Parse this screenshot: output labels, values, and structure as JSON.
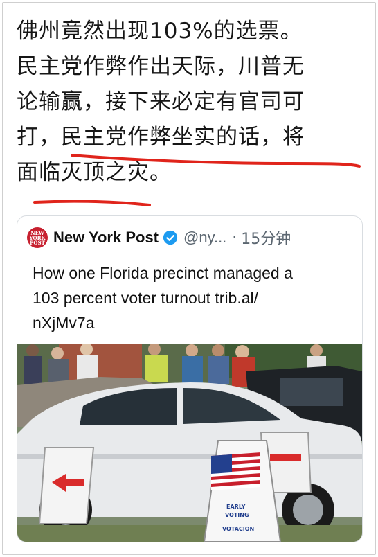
{
  "post": {
    "lines": [
      "佛州竟然出现103%的选票。",
      "民主党作弊作出天际，川普无",
      "论输赢，接下来必定有官司可",
      "打，民主党作弊坐实的话，将",
      "面临灭顶之灾。"
    ]
  },
  "quoted": {
    "logo_text": [
      "NEW",
      "YORK",
      "POST"
    ],
    "account_name": "New York Post",
    "handle": "@ny...",
    "separator": "·",
    "time": "15分钟",
    "text_lines": [
      "How one Florida precinct managed a",
      "103 percent voter turnout trib.al/",
      "nXjMv7a"
    ],
    "image_sign_text": [
      "EARLY",
      "VOTING",
      "VOTACION"
    ]
  },
  "colors": {
    "annotation_red": "#e0241b",
    "nyp_red": "#c7202f",
    "verified_blue": "#1d9bf0",
    "muted": "#5b6670"
  }
}
